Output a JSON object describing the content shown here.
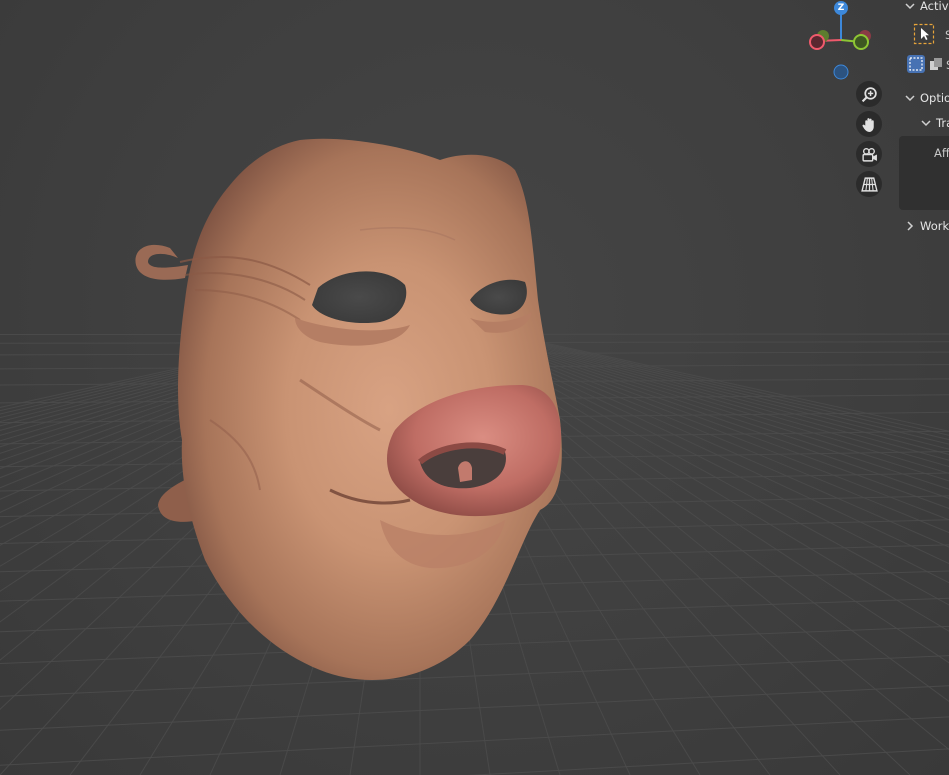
{
  "viewport": {
    "background": "#3d3d3d",
    "grid_color": "#4c4c4c",
    "object": "pig-snout-mask"
  },
  "gizmo": {
    "z_label": "Z",
    "colors": {
      "x": "#f05a6c",
      "y": "#8ec634",
      "z": "#3d88da"
    }
  },
  "nav_buttons": [
    {
      "name": "zoom",
      "icon": "zoom-in-icon"
    },
    {
      "name": "pan",
      "icon": "hand-icon"
    },
    {
      "name": "camera",
      "icon": "camera-icon"
    },
    {
      "name": "ortho",
      "icon": "grid-perspective-icon"
    }
  ],
  "sidebar": {
    "active_tool_label": "Active",
    "select_label": "S",
    "mode_label": "S",
    "options_label": "Optio",
    "transform_label": "Tra",
    "affect_label": "Aff",
    "workspace_label": "Work"
  }
}
